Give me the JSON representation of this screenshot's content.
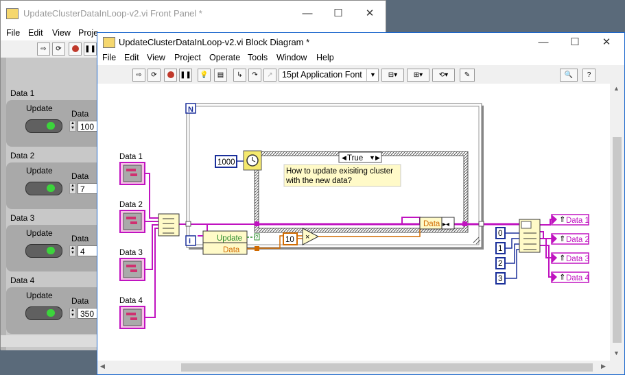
{
  "front_panel": {
    "title": "UpdateClusterDataInLoop-v2.vi Front Panel *",
    "menus": [
      "File",
      "Edit",
      "View",
      "Proje"
    ],
    "clusters": [
      {
        "label": "Data 1",
        "update_label": "Update",
        "data_label": "Data",
        "value": "100"
      },
      {
        "label": "Data 2",
        "update_label": "Update",
        "data_label": "Data",
        "value": "7"
      },
      {
        "label": "Data 3",
        "update_label": "Update",
        "data_label": "Data",
        "value": "4"
      },
      {
        "label": "Data 4",
        "update_label": "Update",
        "data_label": "Data",
        "value": "350"
      }
    ]
  },
  "block_diagram": {
    "title": "UpdateClusterDataInLoop-v2.vi Block Diagram *",
    "menus": [
      "File",
      "Edit",
      "View",
      "Project",
      "Operate",
      "Tools",
      "Window",
      "Help"
    ],
    "font_selector": "15pt Application Font",
    "inputs": [
      "Data 1",
      "Data 2",
      "Data 3",
      "Data 4"
    ],
    "loop_count_label": "N",
    "iteration_label": "i",
    "wait_constant": "1000",
    "case_selector": "True",
    "comment": "How to update exisiting cluster\nwith the new data?",
    "unbundle_fields": [
      "Update",
      "Data"
    ],
    "multiply_constant": "10",
    "bundle_field": "Data",
    "index_constants": [
      "0",
      "1",
      "2",
      "3"
    ],
    "outputs": [
      "Data 1",
      "Data 2",
      "Data 3",
      "Data 4"
    ]
  },
  "window_buttons": {
    "minimize": "—",
    "maximize": "☐",
    "close": "✕"
  }
}
